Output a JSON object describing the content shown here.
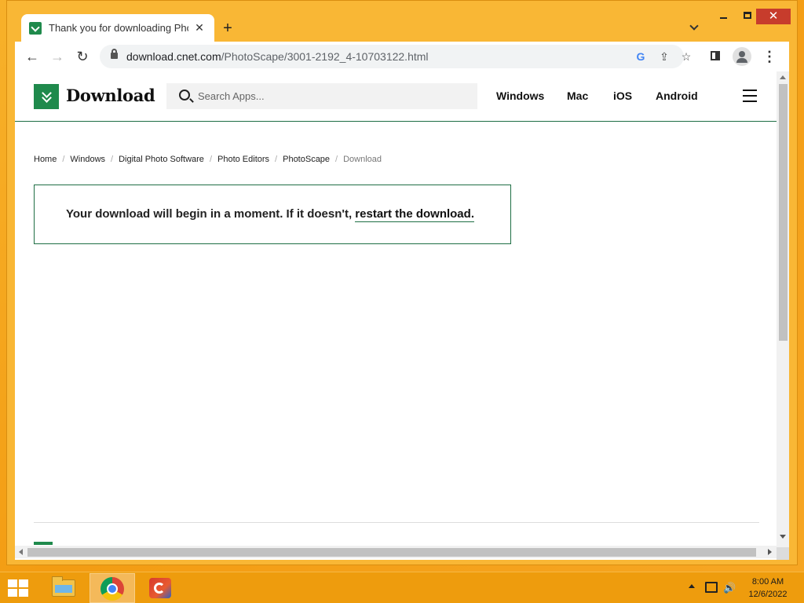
{
  "browser": {
    "tab_title": "Thank you for downloading PhotoScape",
    "tab_close": "✕",
    "new_tab": "+",
    "url_host": "download.cnet.com",
    "url_path": "/PhotoScape/3001-2192_4-10703122.html"
  },
  "site": {
    "logo_text": "Download",
    "search_placeholder": "Search Apps...",
    "nav": [
      "Windows",
      "Mac",
      "iOS",
      "Android"
    ]
  },
  "breadcrumb": [
    "Home",
    "Windows",
    "Digital Photo Software",
    "Photo Editors",
    "PhotoScape",
    "Download"
  ],
  "notice": {
    "text": "Your download will begin in a moment. If it doesn't, ",
    "link": "restart the download."
  },
  "taskbar": {
    "time": "8:00 AM",
    "date": "12/6/2022"
  },
  "icons": [
    "back-icon",
    "forward-icon",
    "reload-icon",
    "lock-icon",
    "google-icon",
    "share-icon",
    "star-icon",
    "side-panel-icon",
    "profile-icon",
    "menu-icon",
    "search-icon",
    "hamburger-icon",
    "windows-start-icon",
    "file-explorer-icon",
    "chrome-icon",
    "ccleaner-icon",
    "network-icon",
    "volume-icon"
  ],
  "colors": {
    "brand_green": "#1f8a4c",
    "desktop_orange": "#f39c12"
  }
}
